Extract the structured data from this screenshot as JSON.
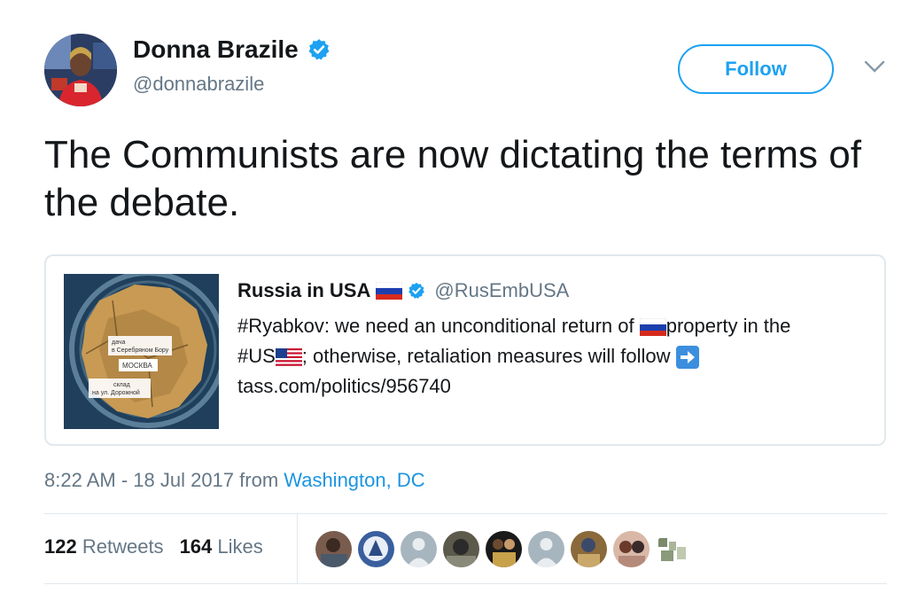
{
  "tweet": {
    "author": {
      "name": "Donna Brazile",
      "handle": "@donnabrazile",
      "verified": true
    },
    "follow_label": "Follow",
    "text": "The Communists are now dictating the terms of the debate.",
    "quoted": {
      "name": "Russia in USA",
      "handle": "@RusEmbUSA",
      "line1_a": "#Ryabkov: we need an unconditional return of ",
      "line1_b": "property in the",
      "line2_a": "#US",
      "line2_b": "; otherwise, retaliation measures will follow ",
      "line3": "tass.com/politics/956740",
      "image_labels": {
        "moskva": "МОСКВА",
        "dacha1": "дача",
        "dacha2": "в Серебряном Бору",
        "sklad1": "склад",
        "sklad2": "на ул. Дорожной"
      }
    },
    "timestamp": "8:22 AM - 18 Jul 2017 from ",
    "location": "Washington, DC",
    "stats": {
      "retweets_count": "122",
      "retweets_label": "Retweets",
      "likes_count": "164",
      "likes_label": "Likes"
    },
    "colors": {
      "accent": "#1da1f2",
      "secondary_text": "#657786",
      "border": "#e1e8ed"
    },
    "icons": [
      "verified-icon",
      "chevron-down-icon",
      "russia-flag-icon",
      "us-flag-icon",
      "right-arrow-icon"
    ]
  }
}
